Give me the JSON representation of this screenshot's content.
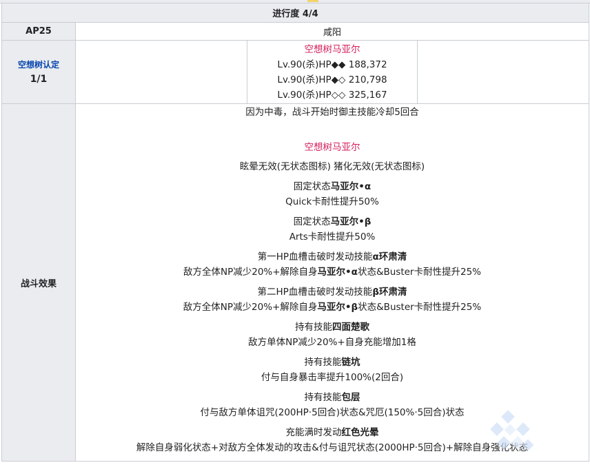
{
  "progress": "进行度 4/4",
  "ap": {
    "label": "AP25",
    "location": "咸阳"
  },
  "cert": {
    "label": "空想树认定",
    "value": "1/1"
  },
  "enemy": {
    "name": "空想树马亚尔",
    "hp_lines": [
      "Lv.90(杀)HP◆◆ 188,372",
      "Lv.90(杀)HP◆◇ 210,798",
      "Lv.90(杀)HP◇◇ 325,167"
    ]
  },
  "effects": {
    "label": "战斗效果",
    "intro": "因为中毒，战斗开始时御主技能冷却5回合",
    "enemy_name": "空想树马亚尔",
    "immunity": "眩晕无效(无状态图标) 猪化无效(无状态图标)",
    "state_a_title_prefix": "固定状态",
    "state_a_title_bold": "马亚尔•α",
    "state_a_desc": "Quick卡耐性提升50%",
    "state_b_title_prefix": "固定状态",
    "state_b_title_bold": "马亚尔•β",
    "state_b_desc": "Arts卡耐性提升50%",
    "break1_prefix": "第一HP血槽击破时发动技能",
    "break1_bold": "α环肃清",
    "break1_desc_a": "敌方全体NP减少20%+解除自身",
    "break1_desc_bold": "马亚尔•α",
    "break1_desc_b": "状态&Buster卡耐性提升25%",
    "break2_prefix": "第二HP血槽击破时发动技能",
    "break2_bold": "β环肃清",
    "break2_desc_a": "敌方全体NP减少20%+解除自身",
    "break2_desc_bold": "马亚尔•β",
    "break2_desc_b": "状态&Buster卡耐性提升25%",
    "skill1_prefix": "持有技能",
    "skill1_bold": "四面楚歌",
    "skill1_desc": "敌方单体NP减少20%+自身充能增加1格",
    "skill2_prefix": "持有技能",
    "skill2_bold": "链坑",
    "skill2_desc": "付与自身暴击率提升100%(2回合)",
    "skill3_prefix": "持有技能",
    "skill3_bold": "包层",
    "skill3_desc": "付与敌方单体诅咒(200HP·5回合)状态&咒厄(150%·5回合)状态",
    "np_prefix": "充能满时发动",
    "np_bold": "红色光晕",
    "np_desc": "解除自身弱化状态+对敌方全体发动的攻击&付与诅咒状态(2000HP·5回合)+解除自身强化状态"
  },
  "colors": {
    "accent_pink": "#d41e5a",
    "header_bg": "#eaecf0",
    "border": "#c8ccd1"
  }
}
